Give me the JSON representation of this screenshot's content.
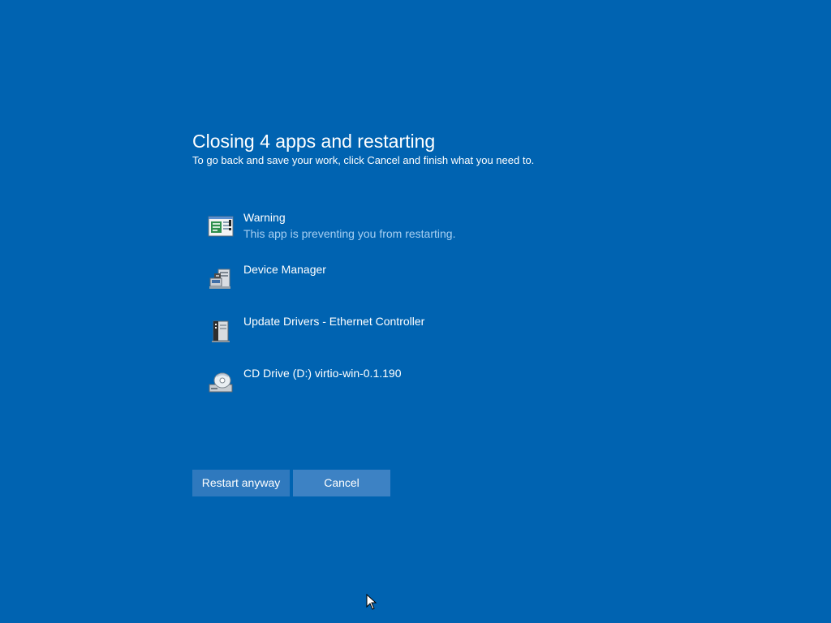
{
  "dialog": {
    "title": "Closing 4 apps and restarting",
    "subtitle": "To go back and save your work, click Cancel and finish what you need to."
  },
  "apps": [
    {
      "name": "Warning",
      "status": "This app is preventing you from restarting.",
      "icon": "warning-app-icon"
    },
    {
      "name": "Device Manager",
      "status": "",
      "icon": "device-manager-icon"
    },
    {
      "name": "Update Drivers - Ethernet Controller",
      "status": "",
      "icon": "update-drivers-icon"
    },
    {
      "name": "CD Drive (D:) virtio-win-0.1.190",
      "status": "",
      "icon": "cd-drive-icon"
    }
  ],
  "buttons": {
    "restart_label": "Restart anyway",
    "cancel_label": "Cancel"
  },
  "colors": {
    "background": "#0063b1",
    "button": "#2f79be",
    "status_text": "#a6cff2"
  }
}
